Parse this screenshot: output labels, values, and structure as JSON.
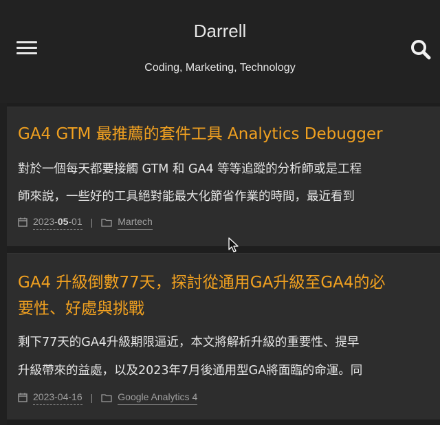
{
  "header": {
    "title": "Darrell",
    "subtitle": "Coding, Marketing, Technology"
  },
  "posts": [
    {
      "title": "GA4 GTM 最推薦的套件工具 Analytics Debugger",
      "excerpt_lines": [
        "對於一個每天都要接觸 GTM 和 GA4 等等追蹤的分析師或是工程",
        "師來說，一些好的工具絕對能最大化節省作業的時間，最近看到"
      ],
      "date_prefix": "2023-",
      "date_highlight": "05",
      "date_suffix": "-01",
      "separator": "|",
      "category": "Martech"
    },
    {
      "title_lines": [
        "GA4 升級倒數77天，探討從通用GA升級至GA4的必",
        "要性、好處與挑戰"
      ],
      "excerpt_lines": [
        "剩下77天的GA4升級期限逼近，本文將解析升級的重要性、提早",
        "升級帶來的益處，以及2023年7月後通用型GA將面臨的命運。同"
      ],
      "date": "2023-04-16",
      "separator": "|",
      "category": "Google Analytics 4"
    }
  ],
  "icons": {
    "menu": "hamburger-icon",
    "search": "search-icon",
    "date": "calendar-icon",
    "category": "folder-icon"
  },
  "colors": {
    "accent": "#f0a020",
    "background": "#252525",
    "card": "#2d2d2d"
  }
}
